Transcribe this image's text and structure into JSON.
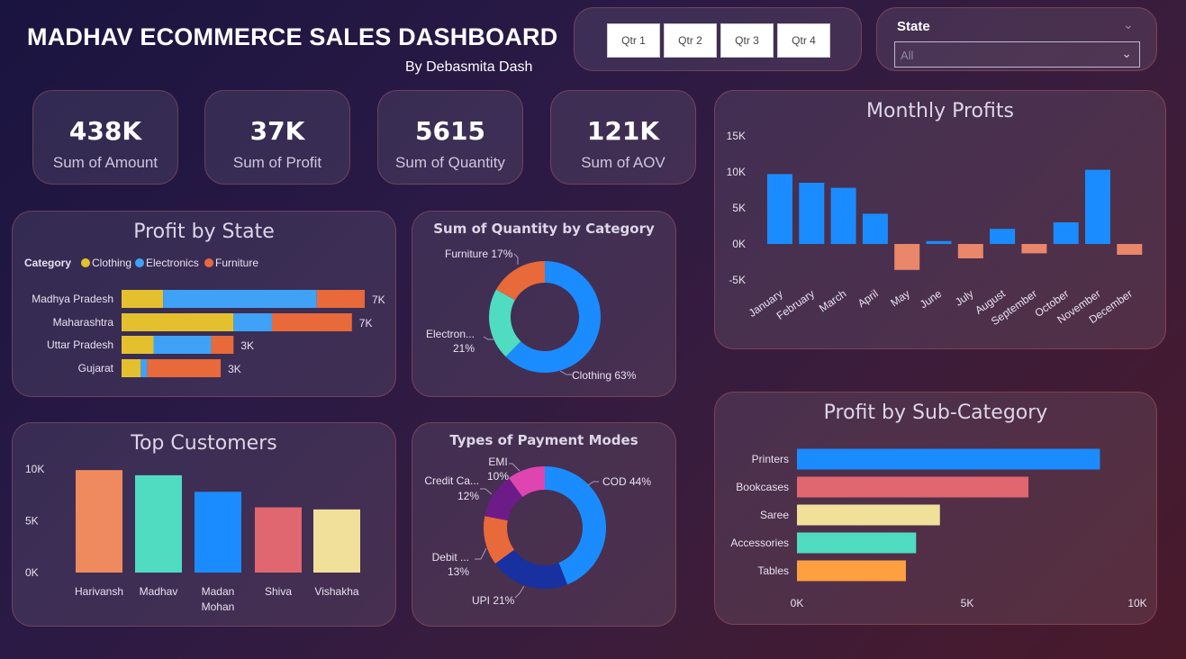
{
  "header": {
    "title": "MADHAV ECOMMERCE SALES DASHBOARD",
    "subtitle": "By Debasmita Dash"
  },
  "filters": {
    "quarters": [
      "Qtr 1",
      "Qtr 2",
      "Qtr 3",
      "Qtr 4"
    ],
    "state_label": "State",
    "state_value": "All"
  },
  "kpis": [
    {
      "value": "438K",
      "label": "Sum of Amount"
    },
    {
      "value": "37K",
      "label": "Sum of Profit"
    },
    {
      "value": "5615",
      "label": "Sum of Quantity"
    },
    {
      "value": "121K",
      "label": "Sum of AOV"
    }
  ],
  "colors": {
    "clothing": "#E5C02E",
    "electronics": "#3FA2F7",
    "furniture": "#E8693A",
    "positive": "#1A8CFF",
    "negative": "#E9876A",
    "cust": [
      "#EE8A5E",
      "#4FDCC0",
      "#1A8CFF",
      "#E0666F",
      "#F0E09A"
    ],
    "subcat": [
      "#1A8CFF",
      "#E0666F",
      "#F0E09A",
      "#4FDCC0",
      "#FFA040"
    ],
    "qty": [
      "#1A8CFF",
      "#4FDCC0",
      "#E8693A"
    ],
    "pay": [
      "#1A8CFF",
      "#1930A0",
      "#E8693A",
      "#6E1B8A",
      "#DE45B0"
    ]
  },
  "chart_data": [
    {
      "id": "profit_by_state",
      "type": "bar",
      "orientation": "horizontal",
      "stacked": true,
      "title": "Profit by State",
      "legend_title": "Category",
      "legend_position": "top-left",
      "categories": [
        "Madhya Pradesh",
        "Maharashtra",
        "Uttar Pradesh",
        "Gujarat"
      ],
      "totals_labels": [
        "7K",
        "7K",
        "3K",
        "3K"
      ],
      "series": [
        {
          "name": "Clothing",
          "values": [
            1.3,
            3.5,
            1.0,
            0.6
          ]
        },
        {
          "name": "Electronics",
          "values": [
            4.8,
            1.2,
            1.8,
            0.2
          ]
        },
        {
          "name": "Furniture",
          "values": [
            1.5,
            2.5,
            0.7,
            2.3
          ]
        }
      ]
    },
    {
      "id": "quantity_by_category",
      "type": "pie",
      "donut": true,
      "title": "Sum of Quantity by Category",
      "labels": [
        "Clothing",
        "Electronics",
        "Furniture"
      ],
      "values": [
        63,
        21,
        17
      ],
      "slice_labels": [
        "Clothing 63%",
        "Electron...\n21%",
        "Furniture 17%"
      ]
    },
    {
      "id": "monthly_profits",
      "type": "bar",
      "title": "Monthly Profits",
      "categories": [
        "January",
        "February",
        "March",
        "April",
        "May",
        "June",
        "July",
        "August",
        "September",
        "October",
        "November",
        "December"
      ],
      "values": [
        9700,
        8500,
        7800,
        4200,
        -3600,
        400,
        -2000,
        2100,
        -1300,
        3000,
        10300,
        -1500
      ],
      "ylim": [
        -5000,
        15000
      ],
      "yticks": [
        "15K",
        "10K",
        "5K",
        "0K",
        "-5K"
      ]
    },
    {
      "id": "top_customers",
      "type": "bar",
      "title": "Top Customers",
      "categories": [
        "Harivansh",
        "Madhav",
        "Madan\nMohan",
        "Shiva",
        "Vishakha"
      ],
      "values": [
        9900,
        9400,
        7800,
        6300,
        6100
      ],
      "ylim": [
        0,
        10000
      ],
      "yticks": [
        "10K",
        "5K",
        "0K"
      ]
    },
    {
      "id": "payment_modes",
      "type": "pie",
      "donut": true,
      "title": "Types of Payment Modes",
      "labels": [
        "COD",
        "UPI",
        "Debit ...",
        "Credit Ca...",
        "EMI"
      ],
      "values": [
        44,
        21,
        13,
        12,
        10
      ],
      "slice_labels": [
        "COD 44%",
        "UPI 21%",
        "Debit ...\n13%",
        "Credit Ca...\n12%",
        "EMI\n10%"
      ]
    },
    {
      "id": "profit_by_subcategory",
      "type": "bar",
      "orientation": "horizontal",
      "title": "Profit by Sub-Category",
      "categories": [
        "Printers",
        "Bookcases",
        "Saree",
        "Accessories",
        "Tables"
      ],
      "values": [
        8900,
        6800,
        4200,
        3500,
        3200
      ],
      "xlim": [
        0,
        10000
      ],
      "xticks": [
        "0K",
        "5K",
        "10K"
      ]
    }
  ]
}
